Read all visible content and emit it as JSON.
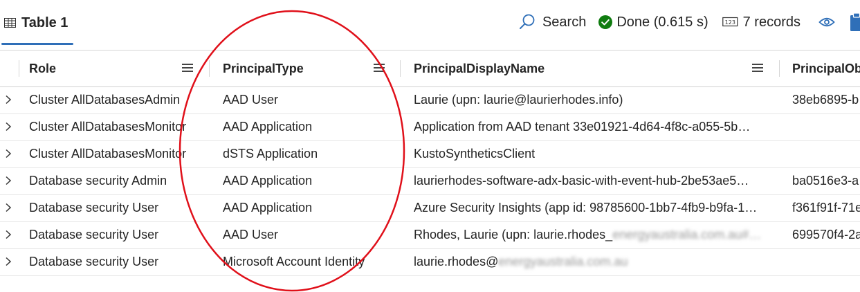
{
  "tab": {
    "label": "Table 1"
  },
  "toolbar": {
    "search_label": "Search",
    "status_text": "Done (0.615 s)",
    "records_text": "7 records",
    "records_icon_text": "123"
  },
  "columns": [
    "Role",
    "PrincipalType",
    "PrincipalDisplayName",
    "PrincipalObj"
  ],
  "rows": [
    {
      "role": "Cluster AllDatabasesAdmin",
      "type": "AAD User",
      "display": "Laurie (upn: laurie@laurierhodes.info)",
      "display_hidden": "",
      "obj": "38eb6895-b"
    },
    {
      "role": "Cluster AllDatabasesMonitor",
      "type": "AAD Application",
      "display": "Application from AAD tenant 33e01921-4d64-4f8c-a055-5b…",
      "display_hidden": "",
      "obj": ""
    },
    {
      "role": "Cluster AllDatabasesMonitor",
      "type": "dSTS Application",
      "display": "KustoSyntheticsClient",
      "display_hidden": "",
      "obj": ""
    },
    {
      "role": "Database security Admin",
      "type": "AAD Application",
      "display": "laurierhodes-software-adx-basic-with-event-hub-2be53ae5…",
      "display_hidden": "",
      "obj": "ba0516e3-a"
    },
    {
      "role": "Database security User",
      "type": "AAD Application",
      "display": "Azure Security Insights (app id: 98785600-1bb7-4fb9-b9fa-1…",
      "display_hidden": "",
      "obj": "f361f91f-71e"
    },
    {
      "role": "Database security User",
      "type": "AAD User",
      "display": "Rhodes, Laurie (upn: laurie.rhodes_",
      "display_hidden": "energyaustralia.com.au#…",
      "obj": "699570f4-2a"
    },
    {
      "role": "Database security User",
      "type": "Microsoft Account Identity",
      "display": "laurie.rhodes@",
      "display_hidden": "energyaustralia.com.au",
      "obj": ""
    }
  ],
  "colors": {
    "accent": "#2f6fb8",
    "success": "#107c10",
    "annotation": "#e0101a"
  },
  "icons": {
    "tab": "table-icon",
    "search": "search-icon",
    "status": "check-circle-icon",
    "records": "number-box-icon",
    "view": "eye-icon",
    "copy": "clipboard-icon",
    "expand": "chevron-right-icon",
    "column_menu": "hamburger-menu-icon"
  }
}
